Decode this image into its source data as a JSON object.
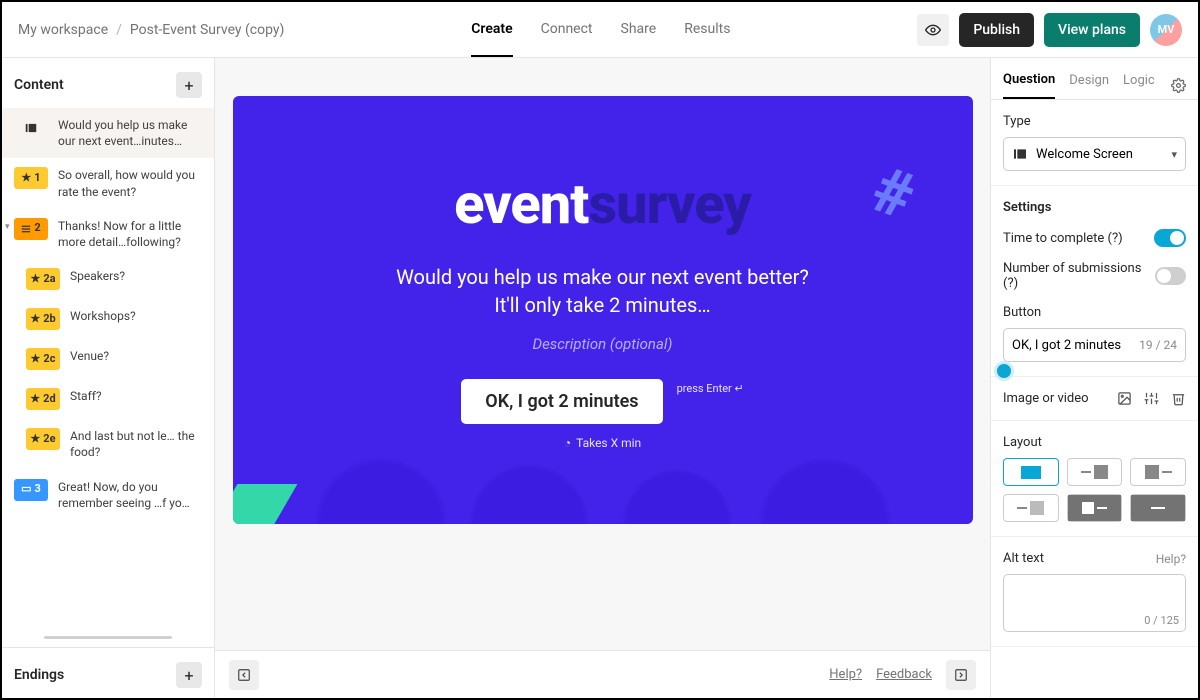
{
  "breadcrumb": {
    "workspace": "My workspace",
    "form": "Post-Event Survey (copy)"
  },
  "topTabs": {
    "create": "Create",
    "connect": "Connect",
    "share": "Share",
    "results": "Results",
    "active": "create"
  },
  "topActions": {
    "publish": "Publish",
    "viewPlans": "View plans",
    "avatar": "MV"
  },
  "sidebar": {
    "contentTitle": "Content",
    "endingsTitle": "Endings",
    "items": [
      {
        "badge": "",
        "color": "welcome",
        "text": "Would you help us make our next event…inutes…",
        "selected": true
      },
      {
        "badge": "1",
        "color": "yellow",
        "text": "So overall, how would you rate the event?"
      },
      {
        "badge": "2",
        "color": "orange",
        "text": "Thanks! Now for a little more detail…following?",
        "group": true
      },
      {
        "badge": "2a",
        "color": "yellow",
        "text": "Speakers?",
        "indent": true
      },
      {
        "badge": "2b",
        "color": "yellow",
        "text": "Workshops?",
        "indent": true
      },
      {
        "badge": "2c",
        "color": "yellow",
        "text": "Venue?",
        "indent": true
      },
      {
        "badge": "2d",
        "color": "yellow",
        "text": "Staff?",
        "indent": true
      },
      {
        "badge": "2e",
        "color": "yellow",
        "text": "And last but not le… the food?",
        "indent": true
      },
      {
        "badge": "3",
        "color": "blue",
        "text": "Great! Now, do you remember seeing …f yo…"
      }
    ]
  },
  "preview": {
    "logoA": "event",
    "logoB": "survey",
    "title1": "Would you help us make our next event better?",
    "title2": "It'll only take 2 minutes…",
    "desc": "Description (optional)",
    "button": "OK, I got 2 minutes",
    "enterHint": "press Enter ↵",
    "timeHint": "Takes X min"
  },
  "canvasFooter": {
    "help": "Help?",
    "feedback": "Feedback"
  },
  "right": {
    "tabs": {
      "question": "Question",
      "design": "Design",
      "logic": "Logic"
    },
    "typeLabel": "Type",
    "typeValue": "Welcome Screen",
    "settingsLabel": "Settings",
    "timeToComplete": "Time to complete (?)",
    "numSubmissions": "Number of submissions (?)",
    "buttonLabel": "Button",
    "buttonValue": "OK, I got 2 minutes",
    "buttonCount": "19 / 24",
    "imageLabel": "Image or video",
    "layoutLabel": "Layout",
    "altLabel": "Alt text",
    "altHelp": "Help?",
    "altCount": "0 / 125"
  }
}
